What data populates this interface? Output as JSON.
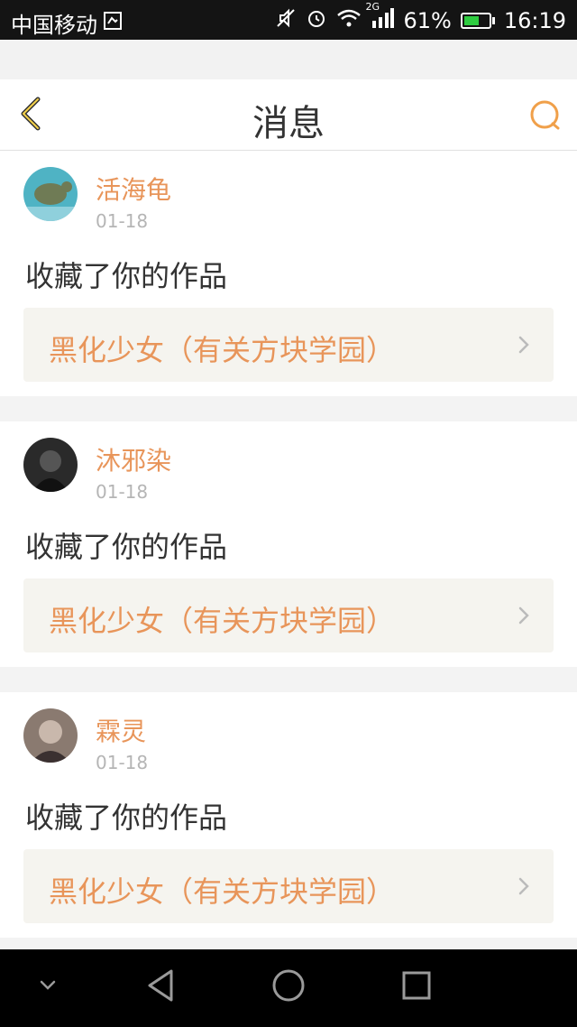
{
  "status_bar": {
    "carrier": "中国移动",
    "network": "2G",
    "battery_percent": "61%",
    "battery_level": 0.61,
    "time": "16:19",
    "icons": [
      "sim-icon",
      "mute-icon",
      "alarm-icon",
      "wifi-icon",
      "signal-icon",
      "battery-icon"
    ]
  },
  "nav": {
    "title": "消息",
    "back_icon": "back-chevron-icon",
    "search_icon": "search-icon"
  },
  "accent_color": "#e8955a",
  "messages": [
    {
      "username": "活海龟",
      "date": "01-18",
      "action": "收藏了你的作品",
      "work_title": "黑化少女（有关方块学园）"
    },
    {
      "username": "沐邪染",
      "date": "01-18",
      "action": "收藏了你的作品",
      "work_title": "黑化少女（有关方块学园）"
    },
    {
      "username": "霖灵",
      "date": "01-18",
      "action": "收藏了你的作品",
      "work_title": "黑化少女（有关方块学园）"
    }
  ],
  "system_nav": {
    "icons": [
      "collapse-icon",
      "back-triangle-icon",
      "home-circle-icon",
      "recents-square-icon"
    ]
  }
}
